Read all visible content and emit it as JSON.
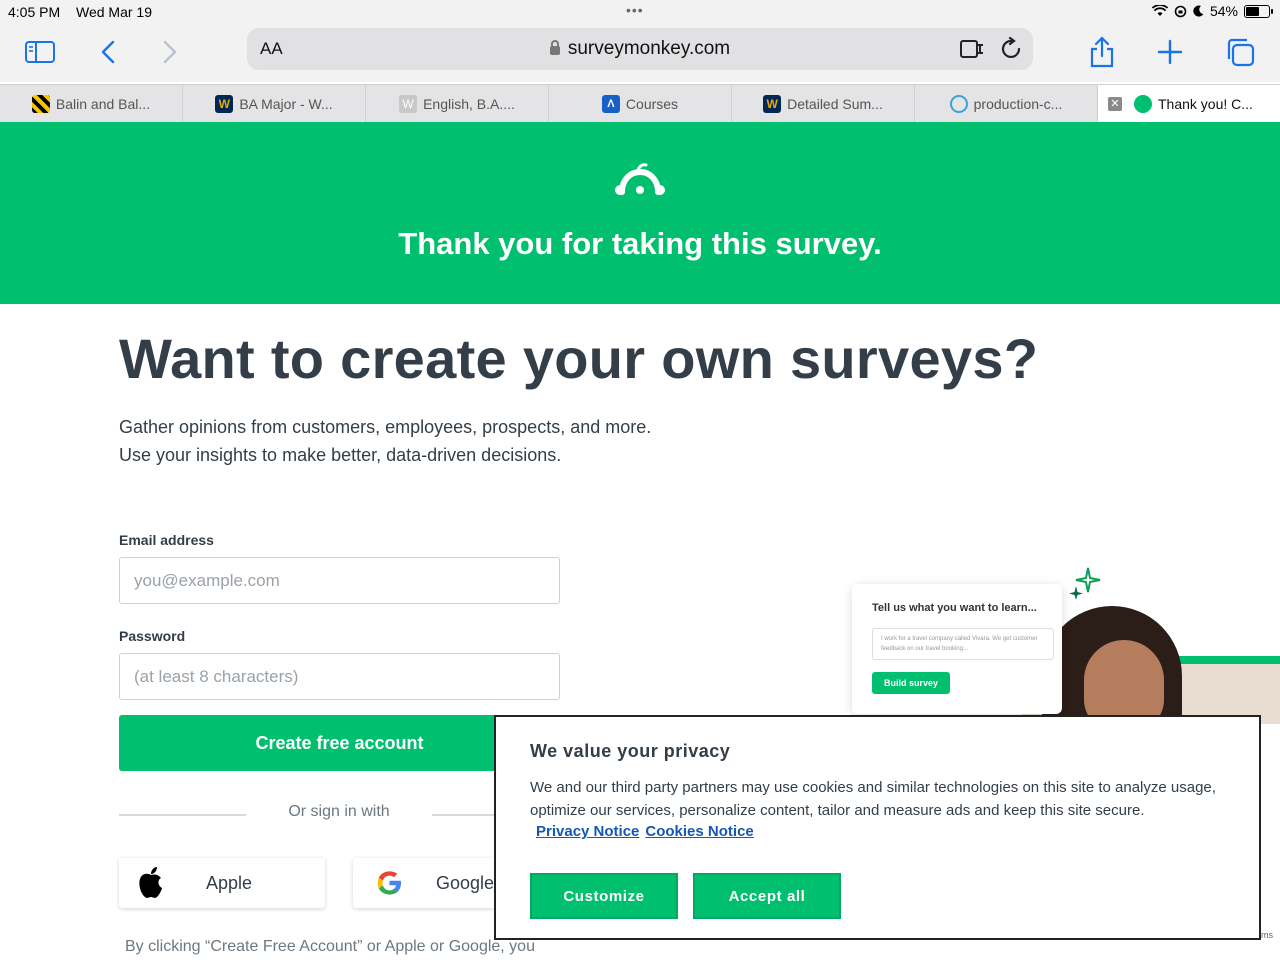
{
  "status_bar": {
    "time": "4:05 PM",
    "date": "Wed Mar 19",
    "battery": "54%",
    "battery_level": 0.54
  },
  "browser": {
    "address_aa": "AA",
    "url": "surveymonkey.com",
    "tabs": [
      {
        "title": "Balin and Bal...",
        "icon": "striped-icon",
        "color": "#f5c400"
      },
      {
        "title": "BA Major - W...",
        "icon": "wvu-icon",
        "color": "#002855"
      },
      {
        "title": "English, B.A....",
        "icon": "w-icon",
        "color": "#c8c8c8"
      },
      {
        "title": "Courses",
        "icon": "canvas-icon",
        "color": "#1760c6"
      },
      {
        "title": "Detailed Sum...",
        "icon": "wvu-icon",
        "color": "#002855"
      },
      {
        "title": "production-c...",
        "icon": "link-icon",
        "color": "#3aa4d8"
      },
      {
        "title": "Thank you! C...",
        "icon": "surveymonkey-icon",
        "color": "#00bf6f"
      }
    ]
  },
  "hero": {
    "thanks": "Thank you for taking this survey.",
    "brand_color": "#00bf6f"
  },
  "signup": {
    "headline": "Want to create your own surveys?",
    "sub_line1": "Gather opinions from customers, employees, prospects, and more.",
    "sub_line2": "Use your insights to make better, data-driven decisions.",
    "email_label": "Email address",
    "email_placeholder": "you@example.com",
    "password_label": "Password",
    "password_placeholder": "(at least 8 characters)",
    "create_button": "Create free account",
    "or_sign_in": "Or sign in with",
    "apple": "Apple",
    "google": "Google",
    "terms": "By clicking “Create Free Account” or Apple or Google, you"
  },
  "promo": {
    "card_title": "Tell us what you want to learn...",
    "card_text": "I work for a travel company called Vivara. We get customer feedback on our travel booking...",
    "card_button": "Build survey"
  },
  "cookie": {
    "title": "We value your privacy",
    "body": "We and our third party partners may use cookies and similar technologies on this site to analyze usage, optimize our services, personalize content, tailor and measure ads and keep this site secure.",
    "privacy_link": "Privacy Notice",
    "cookies_link": "Cookies Notice",
    "customize": "Customize",
    "accept": "Accept all",
    "tail": "ms"
  }
}
